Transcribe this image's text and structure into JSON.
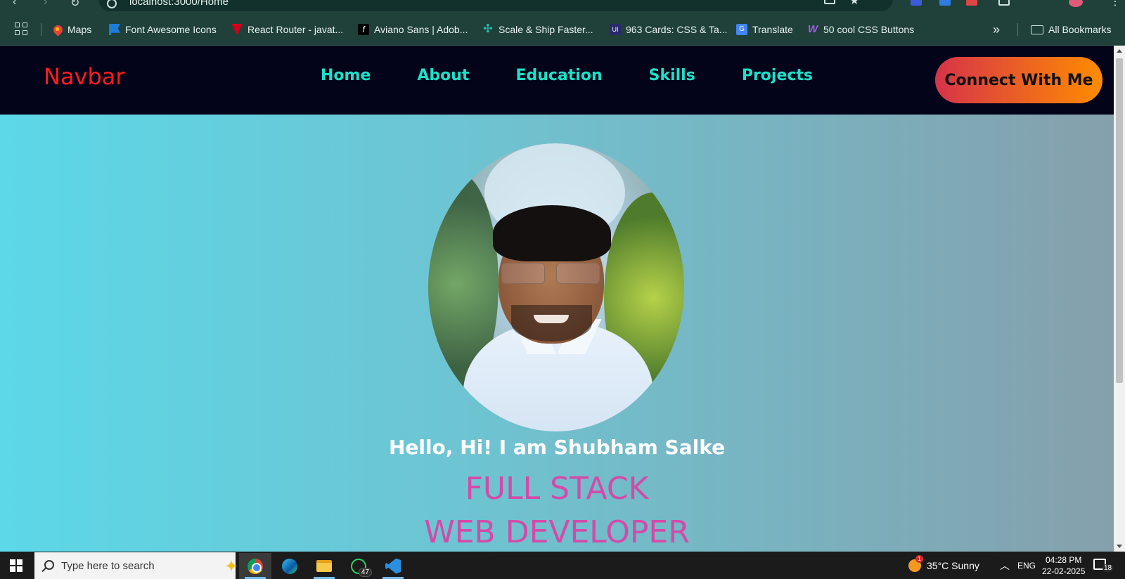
{
  "browser": {
    "url": "localhost:3000/Home"
  },
  "bookmarks": {
    "items": [
      {
        "label": "Maps",
        "icon": "maps-pin-icon",
        "color": "#ea4335"
      },
      {
        "label": "Font Awesome Icons",
        "icon": "flag-icon",
        "color": "#1c7cd6"
      },
      {
        "label": "React Router - javat...",
        "icon": "react-router-icon",
        "color": "#d0021b"
      },
      {
        "label": "Aviano Sans | Adob...",
        "icon": "adobe-fonts-icon",
        "color": "#000000"
      },
      {
        "label": "Scale & Ship Faster...",
        "icon": "scale-ship-icon",
        "color": "#2ec7c0"
      },
      {
        "label": "963 Cards: CSS & Ta...",
        "icon": "uiverse-icon",
        "color": "#2a2a6a"
      },
      {
        "label": "Translate",
        "icon": "google-translate-icon",
        "color": "#4285f4"
      },
      {
        "label": "50 cool CSS Buttons",
        "icon": "w-logo-icon",
        "color": "#a15ce6"
      }
    ],
    "overflow": "»",
    "all_bookmarks": "All Bookmarks"
  },
  "site": {
    "brand": "Navbar",
    "nav": [
      "Home",
      "About",
      "Education",
      "Skills",
      "Projects"
    ],
    "cta": "Connect With Me",
    "greeting": "Hello, Hi! I am Shubham Salke",
    "role_line1": "FULL STACK",
    "role_line2": "WEB DEVELOPER"
  },
  "taskbar": {
    "search_placeholder": "Type here to search",
    "whatsapp_badge": "47",
    "weather": "35°C  Sunny",
    "weather_alert": "1",
    "language": "ENG",
    "time": "04:28 PM",
    "date": "22-02-2025",
    "notifications": "18"
  }
}
